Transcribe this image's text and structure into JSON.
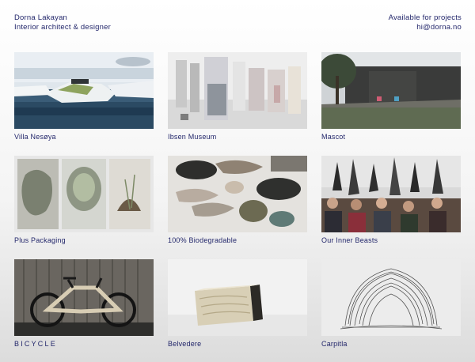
{
  "header": {
    "name": "Dorna Lakayan",
    "role": "Interior architect & designer",
    "availability": "Available for projects",
    "email": "hi@dorna.no"
  },
  "projects": [
    {
      "title": "Villa Nesøya"
    },
    {
      "title": "Ibsen Museum"
    },
    {
      "title": "Mascot"
    },
    {
      "title": "Plus Packaging"
    },
    {
      "title": "100% Biodegradable"
    },
    {
      "title": "Our Inner Beasts"
    },
    {
      "title": "BICYCLE"
    },
    {
      "title": "Belvedere"
    },
    {
      "title": "Carpitla"
    }
  ]
}
